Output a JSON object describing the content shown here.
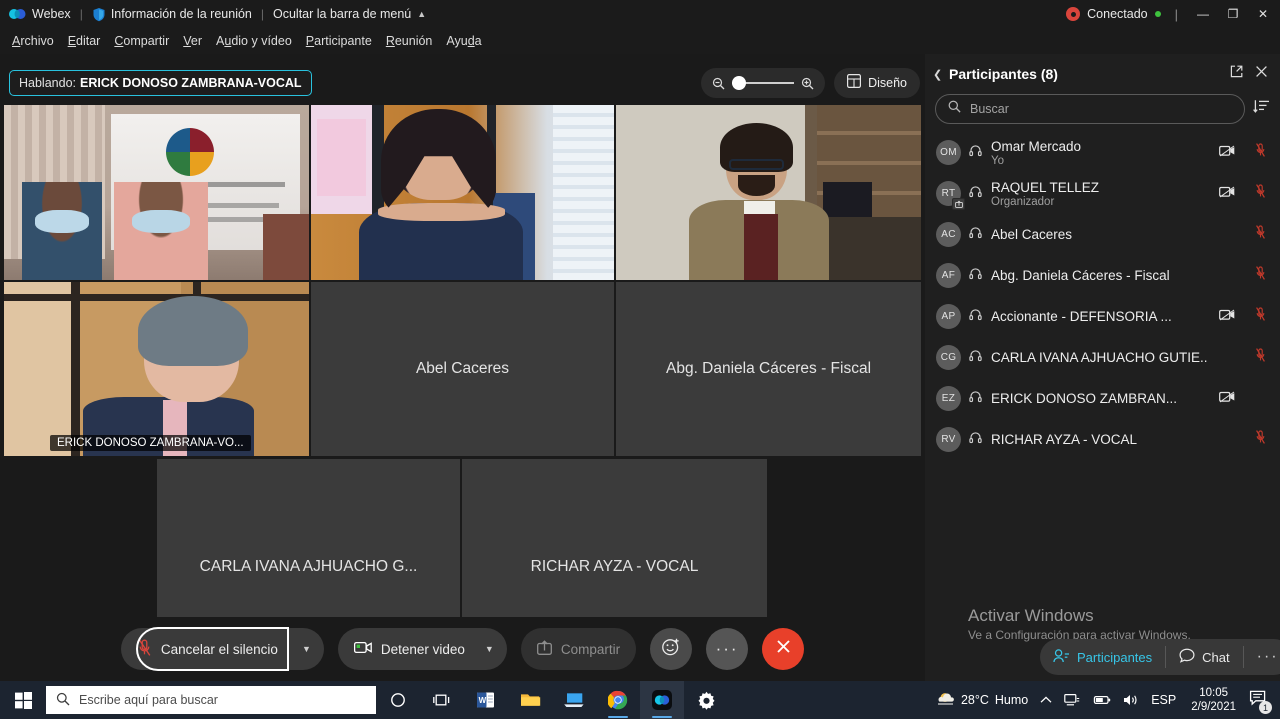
{
  "titlebar": {
    "app_name": "Webex",
    "meeting_info": "Información de la reunión",
    "hide_menu": "Ocultar la barra de menú",
    "connection_status": "Conectado",
    "minimize": "—",
    "maximize": "❐",
    "close": "✕"
  },
  "menubar": {
    "items": [
      {
        "label": "Archivo"
      },
      {
        "label": "Editar"
      },
      {
        "label": "Compartir"
      },
      {
        "label": "Ver"
      },
      {
        "label": "Audio y vídeo"
      },
      {
        "label": "Participante"
      },
      {
        "label": "Reunión"
      },
      {
        "label": "Ayuda"
      }
    ]
  },
  "stage": {
    "speaking_label": "Hablando:",
    "speaking_name": "ERICK DONOSO ZAMBRANA-VOCAL",
    "layout_button": "Diseño",
    "zoom_level": 0
  },
  "tiles": {
    "row1": [
      {
        "type": "video",
        "style": "vid1",
        "name": "",
        "active": false
      },
      {
        "type": "video",
        "style": "vid2",
        "name": "",
        "active": false
      },
      {
        "type": "video",
        "style": "vid3",
        "name": "",
        "active": false
      }
    ],
    "row2": [
      {
        "type": "video",
        "style": "vid4",
        "name": "ERICK DONOSO ZAMBRANA-VO...",
        "active": true
      },
      {
        "type": "placeholder",
        "name": "Abel Caceres",
        "active": false
      },
      {
        "type": "placeholder",
        "name": "Abg. Daniela Cáceres - Fiscal",
        "active": false
      }
    ],
    "row3": [
      {
        "type": "placeholder",
        "name": "CARLA IVANA AJHUACHO G...",
        "active": false
      },
      {
        "type": "placeholder",
        "name": "RICHAR AYZA - VOCAL",
        "active": false
      }
    ]
  },
  "toolbar": {
    "mute_label": "Cancelar el silencio",
    "video_label": "Detener video",
    "share_label": "Compartir",
    "reactions_label": "reactions",
    "more_label": "más opciones",
    "leave_label": "finalizar reunión"
  },
  "panel": {
    "title": "Participantes (8)",
    "search_placeholder": "Buscar",
    "participants": [
      {
        "initials": "OM",
        "name": "Omar Mercado",
        "role": "Yo",
        "host": false,
        "camera": true,
        "muted": true
      },
      {
        "initials": "RT",
        "name": "RAQUEL TELLEZ",
        "role": "Organizador",
        "host": true,
        "camera": true,
        "muted": true
      },
      {
        "initials": "AC",
        "name": "Abel Caceres",
        "role": "",
        "host": false,
        "camera": false,
        "muted": true
      },
      {
        "initials": "AF",
        "name": "Abg. Daniela Cáceres - Fiscal",
        "role": "",
        "host": false,
        "camera": false,
        "muted": true
      },
      {
        "initials": "AP",
        "name": "Accionante - DEFENSORIA ...",
        "role": "",
        "host": false,
        "camera": true,
        "muted": true
      },
      {
        "initials": "CG",
        "name": "CARLA IVANA AJHUACHO GUTIE...",
        "role": "",
        "host": false,
        "camera": false,
        "muted": true
      },
      {
        "initials": "EZ",
        "name": "ERICK DONOSO ZAMBRAN...",
        "role": "",
        "host": false,
        "camera": true,
        "muted": false
      },
      {
        "initials": "RV",
        "name": "RICHAR AYZA - VOCAL",
        "role": "",
        "host": false,
        "camera": false,
        "muted": true
      }
    ]
  },
  "panel_bottom": {
    "participants_label": "Participantes",
    "chat_label": "Chat",
    "more_label": "···"
  },
  "watermark": {
    "line1": "Activar Windows",
    "line2": "Ve a Configuración para activar Windows."
  },
  "taskbar": {
    "search_placeholder": "Escribe aquí para buscar",
    "weather_temp": "28°C",
    "weather_desc": "Humo",
    "language": "ESP",
    "time": "10:05",
    "date": "2/9/2021",
    "notification_count": "1"
  },
  "colors": {
    "accent": "#29c2de",
    "leave_red": "#e8402a",
    "panel_bg": "#1f1f1f",
    "taskbar_bg": "#1c2430",
    "muted_red": "#c0392b"
  }
}
